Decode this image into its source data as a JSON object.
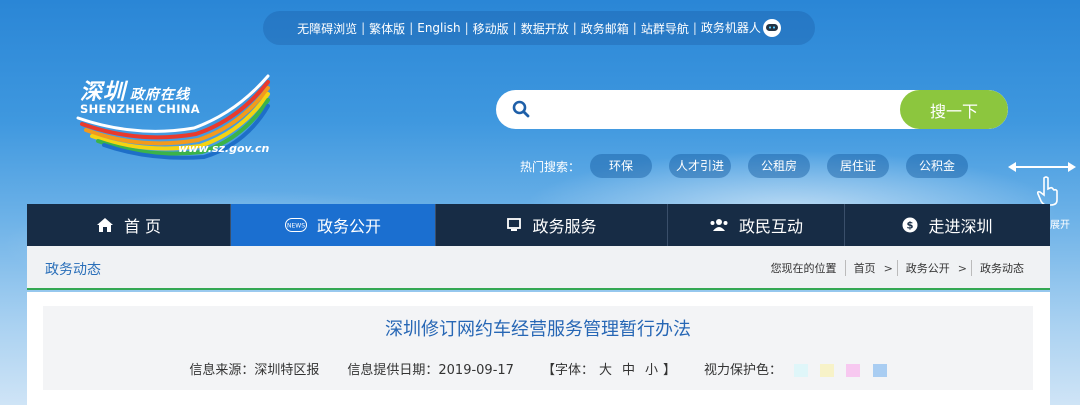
{
  "topbar": {
    "items": [
      "无障碍浏览",
      "繁体版",
      "English",
      "移动版",
      "数据开放",
      "政务邮箱",
      "站群导航",
      "政务机器人"
    ]
  },
  "logo": {
    "cn_main": "深圳",
    "cn_sub": "政府在线",
    "en": "SHENZHEN CHINA",
    "url": "www.sz.gov.cn"
  },
  "search": {
    "placeholder": "",
    "button_label": "搜一下"
  },
  "hot_search": {
    "label": "热门搜索：",
    "tags": [
      "环保",
      "人才引进",
      "公租房",
      "居住证",
      "公积金"
    ]
  },
  "expand_hint": "触碰右侧展开",
  "nav": {
    "items": [
      {
        "label": "首 页",
        "icon": "home-icon"
      },
      {
        "label": "政务公开",
        "icon": "news-icon"
      },
      {
        "label": "政务服务",
        "icon": "monitor-icon"
      },
      {
        "label": "政民互动",
        "icon": "people-icon"
      },
      {
        "label": "走进深圳",
        "icon": "info-icon"
      }
    ],
    "active_index": 1
  },
  "breadcrumb": {
    "section_title": "政务动态",
    "location_label": "您现在的位置",
    "path": [
      "首页",
      "政务公开",
      "政务动态"
    ]
  },
  "article": {
    "title": "深圳修订网约车经营服务管理暂行办法",
    "source": "信息来源：深圳特区报",
    "date": "信息提供日期：2019-09-17",
    "font_prefix": "【字体：",
    "font_sizes": [
      "大",
      "中",
      "小"
    ],
    "font_suffix": "】",
    "eye_care_label": "视力保护色：",
    "eye_care_colors": [
      "#dff6f9",
      "#f7f2c8",
      "#f7c8f0",
      "#a9cdf2"
    ]
  },
  "colors": {
    "nav_active": "#1b6fd0",
    "nav_bg": "#172c45",
    "search_button": "#8cc63e",
    "title_blue": "#2767b5",
    "crumb_border": "#34a853"
  }
}
